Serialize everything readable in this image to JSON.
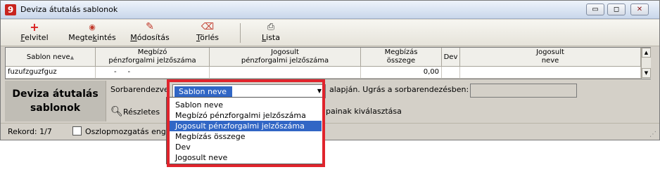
{
  "window": {
    "title": "Deviza átutalás sablonok",
    "app_icon_glyph": "9",
    "controls": {
      "minimize": "▭",
      "maximize": "◻",
      "close": "✕"
    }
  },
  "toolbar": {
    "buttons": [
      {
        "label": "Felvitel",
        "underline": "F",
        "rest": "elvitel",
        "icon": "plus-icon",
        "glyph": "+",
        "color": "#d92020"
      },
      {
        "label": "Megtekintés",
        "pre": "Megte",
        "underline": "k",
        "rest": "intés",
        "icon": "eye-icon",
        "glyph": "👁",
        "color": "#c0392b"
      },
      {
        "label": "Módosítás",
        "underline": "M",
        "rest": "ódosítás",
        "icon": "edit-icon",
        "glyph": "✎",
        "color": "#c0392b"
      },
      {
        "label": "Törlés",
        "underline": "T",
        "rest": "örlés",
        "icon": "trash-icon",
        "glyph": "🗑",
        "color": "#c0392b"
      },
      {
        "label": "Lista",
        "underline": "L",
        "rest": "ista",
        "icon": "printer-icon",
        "glyph": "🖶",
        "color": "#333333"
      }
    ]
  },
  "grid": {
    "columns": [
      {
        "l1": "Sablon neve",
        "l2": ""
      },
      {
        "l1": "Megbízó",
        "l2": "pénzforgalmi jelzőszáma"
      },
      {
        "l1": "Jogosult",
        "l2": "pénzforgalmi jelzőszáma"
      },
      {
        "l1": "Megbízás",
        "l2": "összege"
      },
      {
        "l1": "Dev",
        "l2": ""
      },
      {
        "l1": "Jogosult",
        "l2": "neve"
      }
    ],
    "sort_indicator": "▲",
    "rows": [
      {
        "sablon_neve": "fuzufzguzfguz",
        "megbizo": "-     -",
        "jogosult_pf": "",
        "osszeg": "0,00",
        "dev": "",
        "jogosult_neve": ""
      }
    ]
  },
  "panel": {
    "title_l1": "Deviza átutalás",
    "title_l2": "sablonok",
    "sort_label": "Sorbarendezve",
    "sort_value": "Sablon neve",
    "alapjan_text": "alapján.  Ugrás a sorbarendezésben:",
    "jump_value": "",
    "details_label": "Részletes",
    "background_text": "painak kiválasztása"
  },
  "dropdown": {
    "options": [
      "Sablon neve",
      "Megbízó pénzforgalmi jelzőszáma",
      "Jogosult pénzforgalmi jelzőszáma",
      "Megbízás összege",
      "Dev",
      "Jogosult neve"
    ],
    "selected_index": 2
  },
  "status": {
    "rekord": "Rekord:   1/7",
    "checkbox_label": "Oszlopmozgatás engedé",
    "checkbox_checked": false
  },
  "colors": {
    "highlight": "#3166c5",
    "annotation_red": "#e0242c"
  }
}
